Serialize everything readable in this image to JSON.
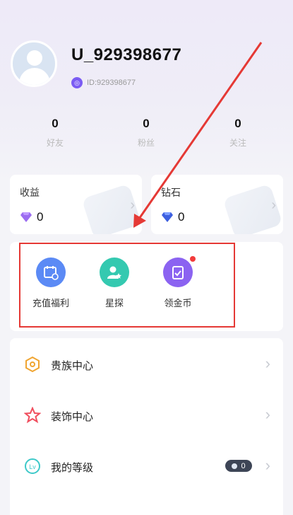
{
  "profile": {
    "username": "U_929398677",
    "uid": "ID:929398677"
  },
  "stats": [
    {
      "value": "0",
      "label": "好友"
    },
    {
      "value": "0",
      "label": "粉丝"
    },
    {
      "value": "0",
      "label": "关注"
    }
  ],
  "wallet": {
    "earnings": {
      "title": "收益",
      "value": "0"
    },
    "diamonds": {
      "title": "钻石",
      "value": "0"
    }
  },
  "functions": [
    {
      "label": "充值福利",
      "icon": "gift-calendar-icon",
      "color": "#5b8af5"
    },
    {
      "label": "星探",
      "icon": "talent-scout-icon",
      "color": "#34c9b0"
    },
    {
      "label": "领金币",
      "icon": "gold-coin-icon",
      "color": "#8b63f1"
    }
  ],
  "menu": [
    {
      "label": "贵族中心",
      "icon": "noble-shield-icon"
    },
    {
      "label": "装饰中心",
      "icon": "decoration-star-icon"
    },
    {
      "label": "我的等级",
      "icon": "level-icon",
      "level": "0"
    }
  ],
  "annotation_color": "#e53935"
}
